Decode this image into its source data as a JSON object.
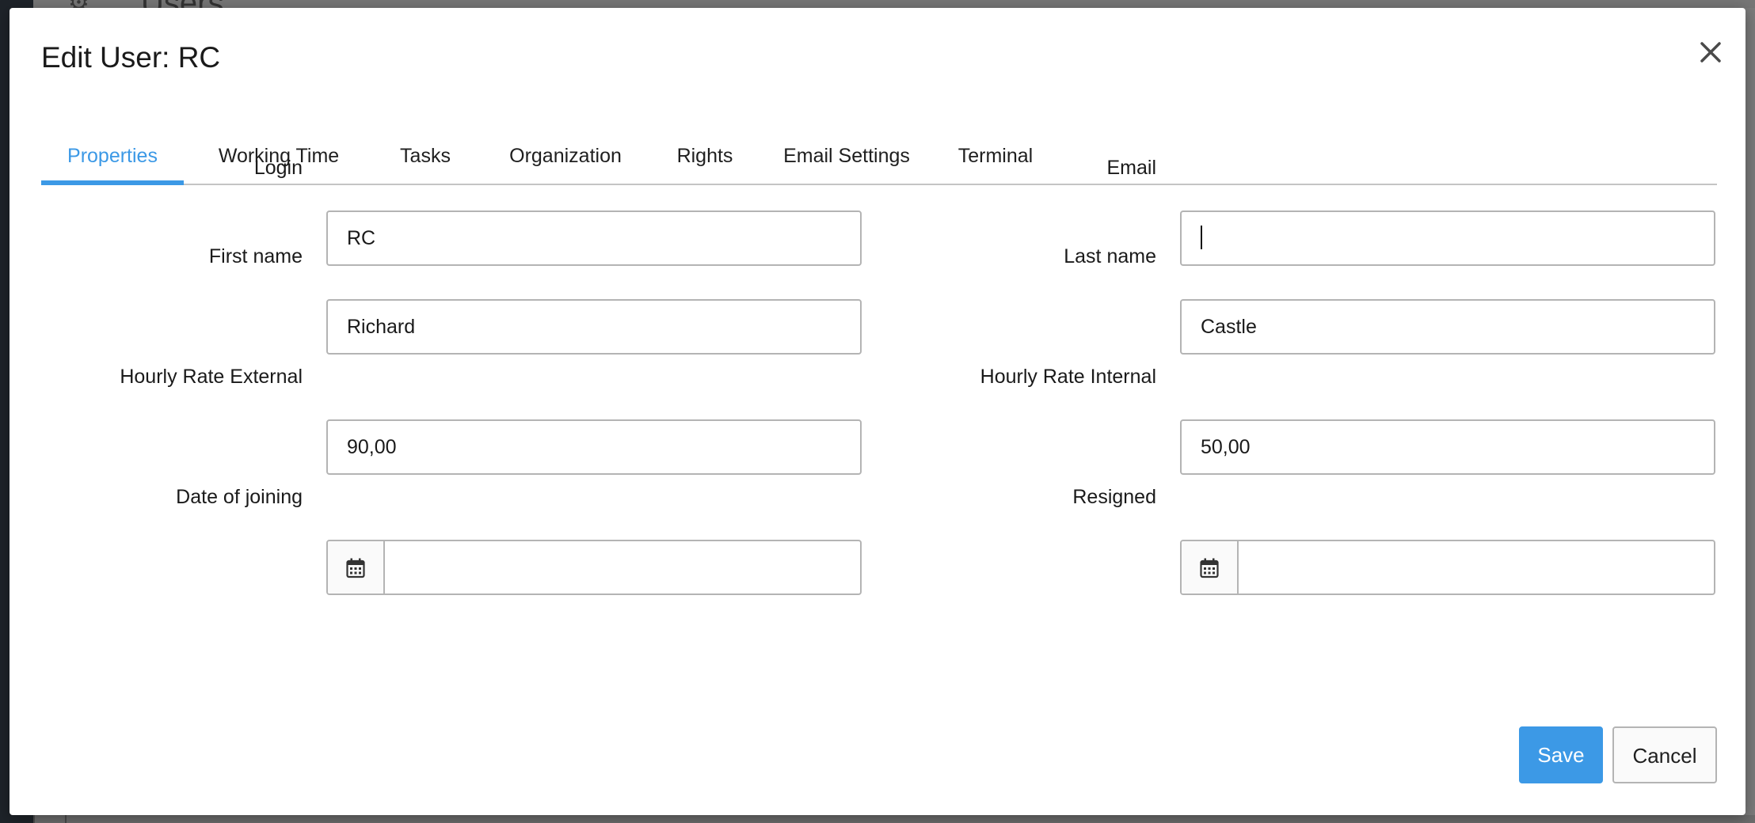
{
  "background": {
    "header_title": "Users",
    "header_icon": "gear-icon"
  },
  "dialog": {
    "title": "Edit User: RC",
    "close_icon": "close-icon"
  },
  "tabs": [
    {
      "label": "Properties",
      "active": true
    },
    {
      "label": "Working Time",
      "active": false
    },
    {
      "label": "Tasks",
      "active": false
    },
    {
      "label": "Organization",
      "active": false
    },
    {
      "label": "Rights",
      "active": false
    },
    {
      "label": "Email Settings",
      "active": false
    },
    {
      "label": "Terminal",
      "active": false
    }
  ],
  "form": {
    "login": {
      "label": "Login",
      "value": "RC"
    },
    "email": {
      "label": "Email",
      "value": ""
    },
    "first_name": {
      "label": "First name",
      "value": "Richard"
    },
    "last_name": {
      "label": "Last name",
      "value": "Castle"
    },
    "hourly_rate_external": {
      "label": "Hourly Rate External",
      "value": "90,00"
    },
    "hourly_rate_internal": {
      "label": "Hourly Rate Internal",
      "value": "50,00"
    },
    "date_of_joining": {
      "label": "Date of joining",
      "value": "",
      "icon": "calendar-icon"
    },
    "resigned": {
      "label": "Resigned",
      "value": "",
      "icon": "calendar-icon"
    }
  },
  "buttons": {
    "save": "Save",
    "cancel": "Cancel"
  },
  "colors": {
    "accent": "#3c99e6",
    "border": "#b4b4b4",
    "overlay": "#7b7b7b"
  }
}
